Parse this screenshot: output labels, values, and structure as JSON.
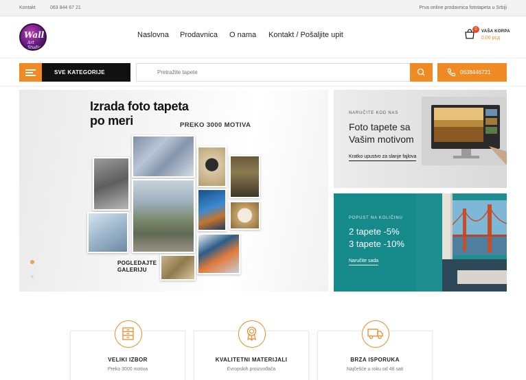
{
  "topbar": {
    "contact_label": "Kontakt",
    "phone": "063 844 67 21",
    "tagline": "Prva online prodavnica fototapeta u Srbiji"
  },
  "header": {
    "logo_text_main": "Wall",
    "logo_text_sub": "Art Studio",
    "nav": [
      "Naslovna",
      "Prodavnica",
      "O nama",
      "Kontakt / Pošaljite upit"
    ],
    "cart": {
      "title": "VAŠA KORPA",
      "price": "0,00 рсд",
      "count": "0"
    }
  },
  "search": {
    "categories_label": "SVE KATEGORIJE",
    "placeholder": "Pretražite tapete",
    "phone_label": "0638446721"
  },
  "hero": {
    "title_line1": "Izrada foto tapeta",
    "title_line2": "po meri",
    "subtitle": "PREKO 3000 MOTIVA",
    "cta_line1": "POGLEDAJTE",
    "cta_line2": "GALERIJU"
  },
  "promo1": {
    "eyebrow": "NARUČITE KOD NAS",
    "line1": "Foto tapete sa",
    "line2": "Vašim motivom",
    "link": "Kratko upustvo za slanje fajlova"
  },
  "promo2": {
    "eyebrow": "POPUST NA KOLIČINU",
    "line1": "2 tapete -5%",
    "line2": "3 tapete -10%",
    "link": "Naručite sada"
  },
  "features": [
    {
      "title": "VELIKI IZBOR",
      "subtitle": "Preko 3000 motiva",
      "icon": "drawer-icon"
    },
    {
      "title": "KVALITETNI MATERIJALI",
      "subtitle": "Evropskih proizvođača",
      "icon": "award-icon"
    },
    {
      "title": "BRZA ISPORUKA",
      "subtitle": "Najčešće u roku od 48 sati",
      "icon": "truck-icon"
    }
  ],
  "colors": {
    "accent": "#f08a24",
    "dark": "#111111",
    "teal": "#16898b",
    "badge": "#e8492b"
  }
}
